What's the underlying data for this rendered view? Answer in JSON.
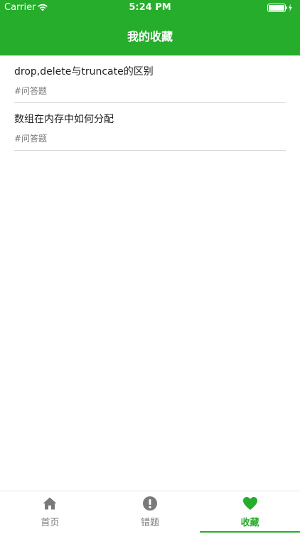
{
  "status_bar": {
    "carrier": "Carrier",
    "time": "5:24 PM"
  },
  "header": {
    "title": "我的收藏"
  },
  "favorites": [
    {
      "title": "drop,delete与truncate的区别",
      "tag": "#问答题"
    },
    {
      "title": "数组在内存中如何分配",
      "tag": "#问答题"
    }
  ],
  "tabs": [
    {
      "label": "首页",
      "icon": "home-icon"
    },
    {
      "label": "错题",
      "icon": "alert-icon"
    },
    {
      "label": "收藏",
      "icon": "heart-icon",
      "active": true
    }
  ],
  "colors": {
    "accent": "#25ad2b",
    "inactive": "#7a7a7a"
  }
}
